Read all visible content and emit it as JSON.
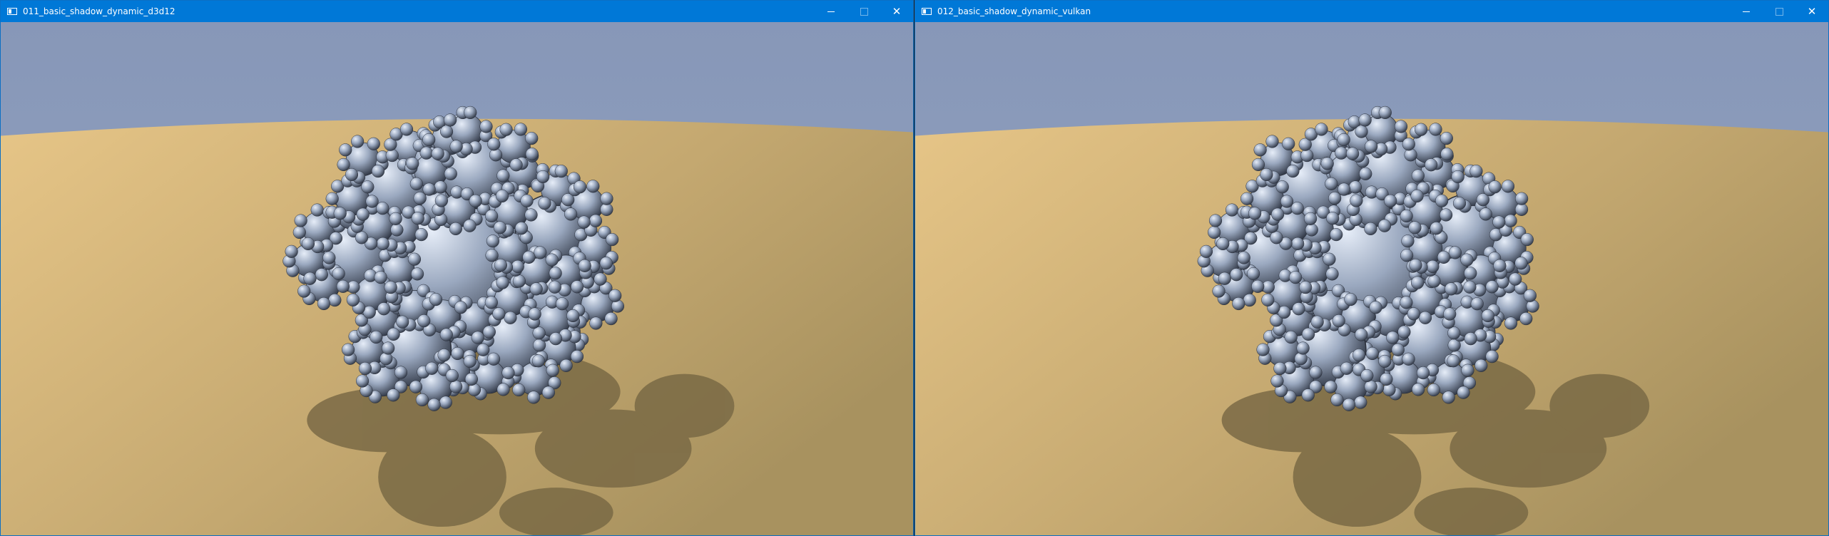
{
  "windows": [
    {
      "title": "011_basic_shadow_dynamic_d3d12",
      "icon": "app-window-icon",
      "controls": [
        "minimize-icon",
        "maximize-icon",
        "close-icon"
      ]
    },
    {
      "title": "012_basic_shadow_dynamic_vulkan",
      "icon": "app-window-icon",
      "controls": [
        "minimize-icon",
        "maximize-icon",
        "close-icon"
      ]
    }
  ],
  "glyphs": {
    "close": "✕"
  },
  "colors": {
    "titlebar": "#0078d7",
    "sky": "#8e9fbd",
    "ground": "#c9ad72",
    "sphere": "#9aa8bf",
    "shadow": "#7a6a45"
  }
}
